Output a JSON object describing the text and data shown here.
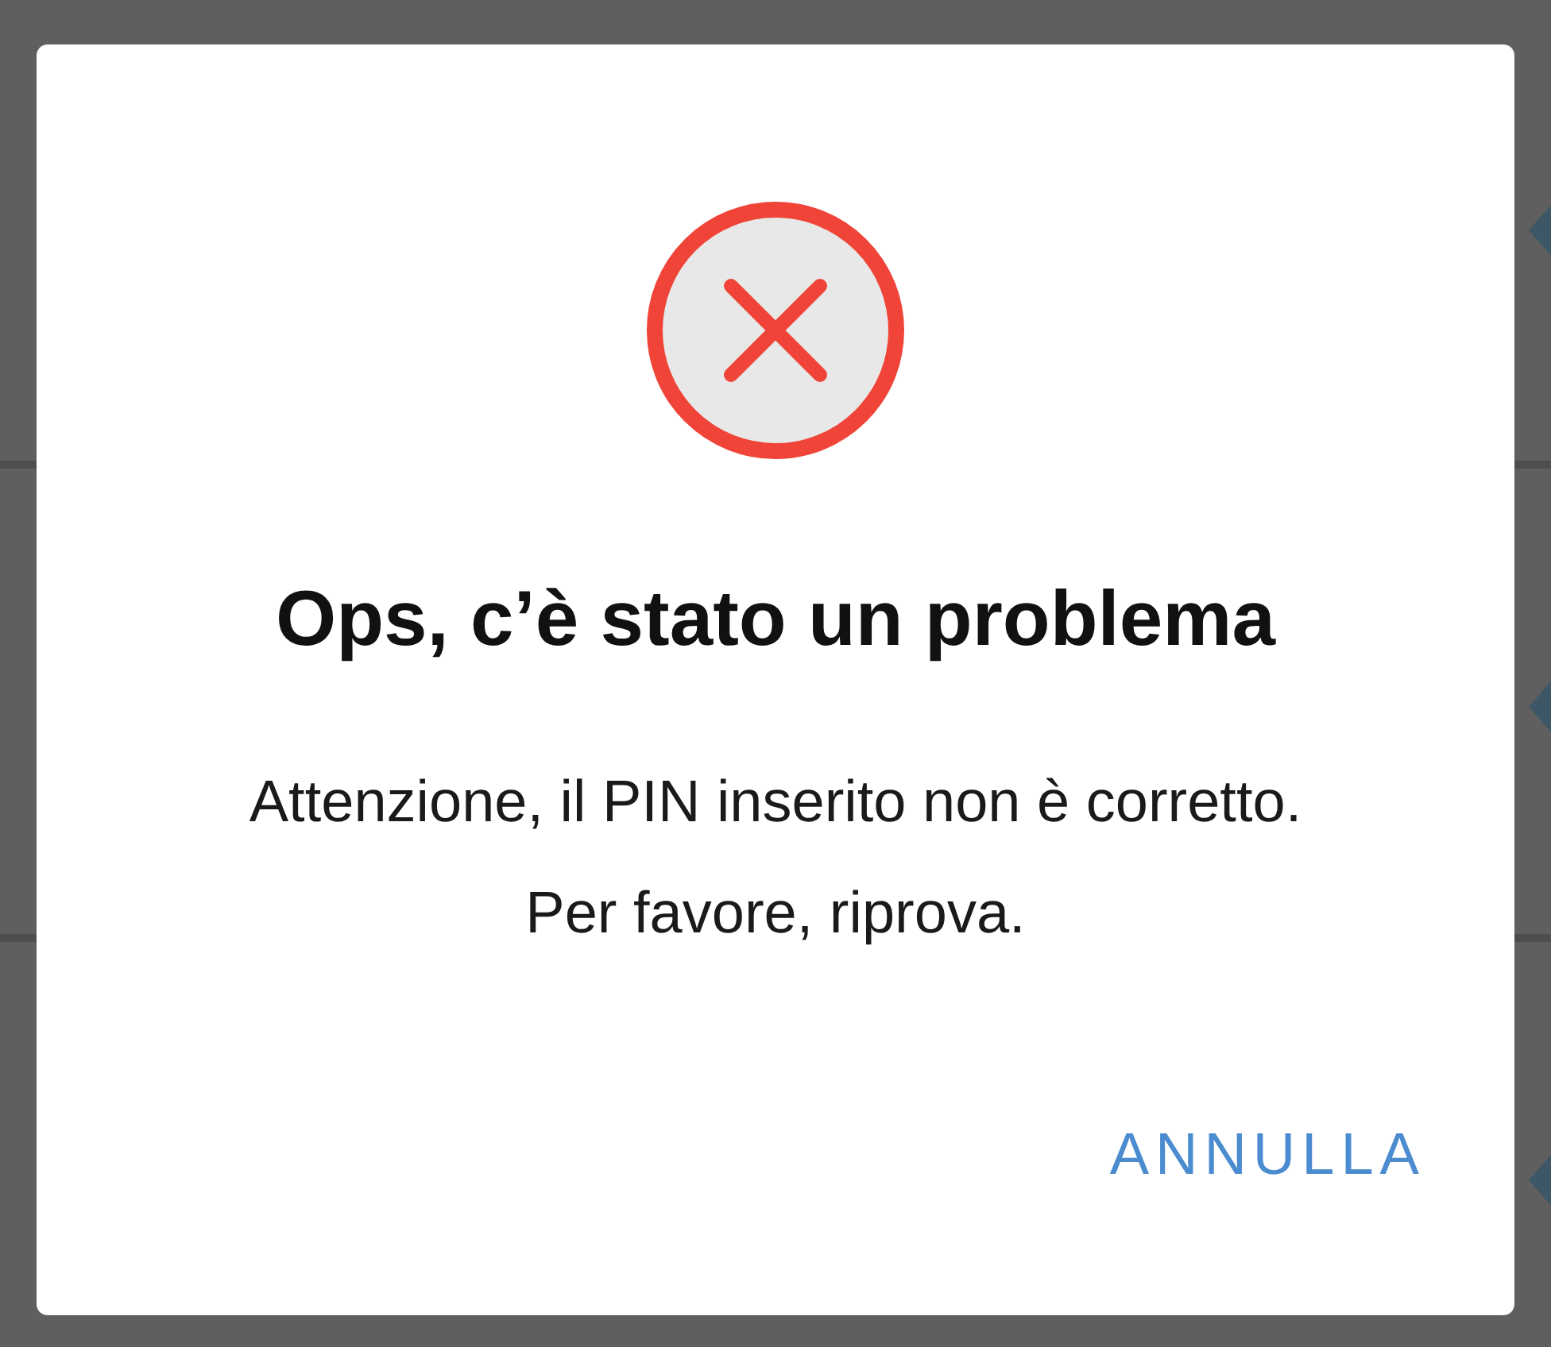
{
  "background_list": {
    "rows": [
      {
        "kind": "entry"
      },
      {
        "kind": "entry"
      },
      {
        "kind": "entry"
      }
    ]
  },
  "dialog": {
    "title": "Ops, c’è stato un problema",
    "message": "Attenzione, il PIN inserito non è corretto. Per favore, riprova.",
    "buttons": [
      "ANNULLA"
    ]
  }
}
